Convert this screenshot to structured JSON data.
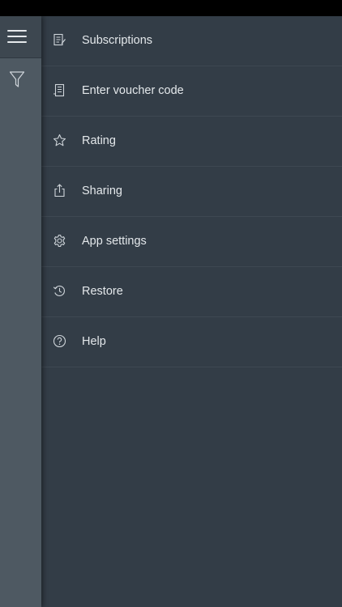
{
  "rail": {
    "menu_icon": "hamburger-icon",
    "filter_icon": "filter-icon"
  },
  "menu": {
    "items": [
      {
        "label": "Subscriptions",
        "icon": "subscriptions-icon"
      },
      {
        "label": "Enter voucher code",
        "icon": "voucher-icon"
      },
      {
        "label": "Rating",
        "icon": "star-icon"
      },
      {
        "label": "Sharing",
        "icon": "share-icon"
      },
      {
        "label": "App settings",
        "icon": "gear-icon"
      },
      {
        "label": "Restore",
        "icon": "restore-icon"
      },
      {
        "label": "Help",
        "icon": "help-icon"
      }
    ]
  },
  "colors": {
    "background": "#333d47",
    "rail": "#4e5962",
    "text": "#e4e8eb"
  }
}
